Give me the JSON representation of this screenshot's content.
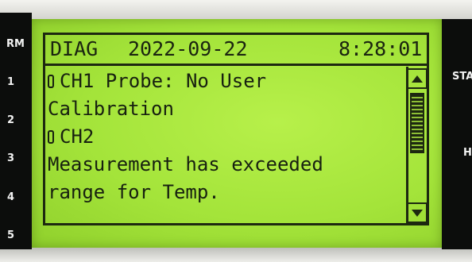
{
  "side_labels": {
    "left": [
      "RM",
      "1",
      "2",
      "3",
      "4",
      "5"
    ],
    "right": [
      "STA",
      "H"
    ]
  },
  "header": {
    "mode": "DIAG",
    "date": "2022-09-22",
    "time": "8:28:01"
  },
  "messages": {
    "line1": "CH1 Probe: No User",
    "line2": "Calibration",
    "line3": "CH2",
    "line4": "Measurement has exceeded",
    "line5": "range for Temp."
  },
  "scrollbar": {
    "up_icon": "triangle-up-icon",
    "down_icon": "triangle-down-icon"
  },
  "colors": {
    "lcd_background": "#a4e43a",
    "lcd_text": "#1a2410",
    "panel": "#0c0d0c",
    "panel_text": "#f2f2f2"
  }
}
